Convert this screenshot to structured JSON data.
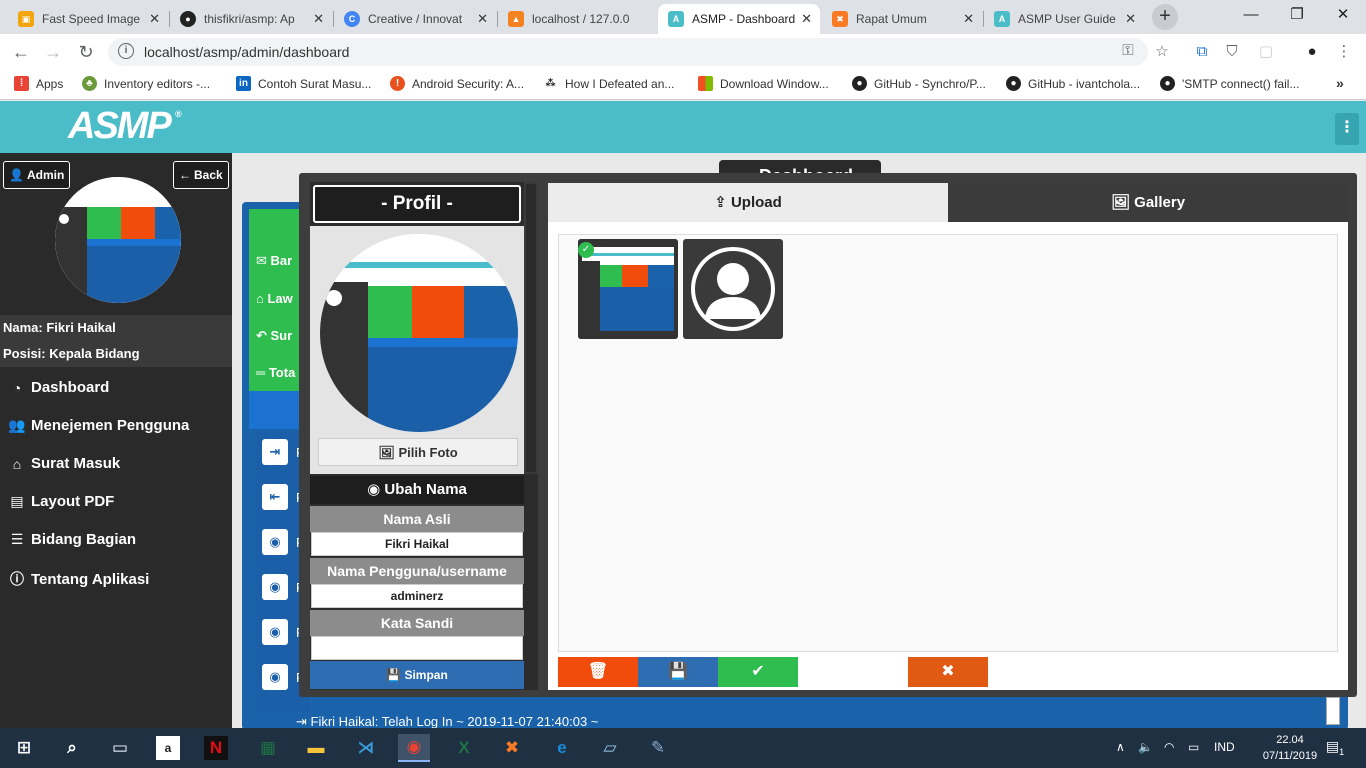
{
  "browser": {
    "tabs": [
      {
        "label": "Fast Speed Image",
        "favicon": "image-icon",
        "color": "#f2a60c"
      },
      {
        "label": "thisfikri/asmp: Ap",
        "favicon": "github-icon",
        "color": "#222222"
      },
      {
        "label": "Creative / Innovat",
        "favicon": "c-icon",
        "color": "#4285f4"
      },
      {
        "label": "localhost / 127.0.0",
        "favicon": "phpmyadmin-icon",
        "color": "#f58220"
      },
      {
        "label": "ASMP - Dashboard",
        "favicon": "asmp-icon",
        "color": "#4bbdc9"
      },
      {
        "label": "Rapat Umum",
        "favicon": "xampp-icon",
        "color": "#fb7a24"
      },
      {
        "label": "ASMP User Guide",
        "favicon": "asmp-icon",
        "color": "#4bbdc9"
      }
    ],
    "active_tab": 4,
    "url": "localhost/asmp/admin/dashboard",
    "bookmarks": [
      {
        "label": "Apps",
        "icon": "apps-grid-icon",
        "color": "#e94335"
      },
      {
        "label": "Inventory editors -...",
        "icon": "tree-icon",
        "color": "#6a9a3a"
      },
      {
        "label": "Contoh Surat Masu...",
        "icon": "linkedin-icon",
        "color": "#0a66c2"
      },
      {
        "label": "Android Security: A...",
        "icon": "android-security-icon",
        "color": "#e8501e"
      },
      {
        "label": "How I Defeated an...",
        "icon": "dots-icon",
        "color": "#222222"
      },
      {
        "label": "Download Window...",
        "icon": "windows-icon",
        "color": "#f25022"
      },
      {
        "label": "GitHub - Synchro/P...",
        "icon": "github-icon",
        "color": "#222222"
      },
      {
        "label": "GitHub - ivantchola...",
        "icon": "github-icon",
        "color": "#222222"
      },
      {
        "label": "'SMTP connect() fail...",
        "icon": "github-icon",
        "color": "#222222"
      }
    ]
  },
  "app": {
    "logo": "ASMP",
    "logo_mark": "®",
    "header_color": "#4bbdc9"
  },
  "sidebar": {
    "admin_label": "Admin",
    "back_label": "Back",
    "nama": "Nama: Fikri Haikal",
    "posisi": "Posisi: Kepala Bidang",
    "items": [
      {
        "label": "Dashboard",
        "icon": "dashboard-icon"
      },
      {
        "label": "Menejemen Pengguna",
        "icon": "users-icon"
      },
      {
        "label": "Surat Masuk",
        "icon": "inbox-icon"
      },
      {
        "label": "Layout PDF",
        "icon": "pdf-icon"
      },
      {
        "label": "Bidang Bagian",
        "icon": "list-icon"
      },
      {
        "label": "Tentang Aplikasi",
        "icon": "info-icon"
      }
    ]
  },
  "main": {
    "dashboard_title": "Dashboard",
    "green_rows": [
      "Bar",
      "Law",
      "Sur",
      "Tota"
    ],
    "list_rows": [
      {
        "icon": "sign-in-icon",
        "text": "F"
      },
      {
        "icon": "sign-out-icon",
        "text": "F"
      },
      {
        "icon": "eye-icon",
        "text": "F"
      },
      {
        "icon": "eye-icon",
        "text": "F"
      },
      {
        "icon": "eye-icon",
        "text": "F"
      },
      {
        "icon": "eye-icon",
        "text": "F"
      }
    ],
    "log_line": "Fikri Haikal: Telah Log In ~ 2019-11-07 21:40:03 ~"
  },
  "modal": {
    "profil_title": "- Profil -",
    "pilih_foto": "Pilih Foto",
    "ubah_nama": "Ubah Nama",
    "nama_asli_label": "Nama Asli",
    "nama_asli_value": "Fikri Haikal",
    "username_label": "Nama Pengguna/username",
    "username_value": "adminerz",
    "password_label": "Kata Sandi",
    "password_value": "",
    "simpan": "Simpan",
    "tab_upload": "Upload",
    "tab_gallery": "Gallery",
    "actions": [
      {
        "name": "delete-button",
        "icon": "trash-icon",
        "glyph": "🗑",
        "color": "#f24c0c"
      },
      {
        "name": "save-button",
        "icon": "floppy-icon",
        "glyph": "💾",
        "color": "#2f6db2"
      },
      {
        "name": "confirm-button",
        "icon": "check-icon",
        "glyph": "✔",
        "color": "#2ebd4e"
      },
      {
        "name": "close-button",
        "icon": "x-icon",
        "glyph": "✖",
        "color": "#e05a14"
      }
    ]
  },
  "taskbar": {
    "lang": "IND",
    "time": "22.04",
    "date": "07/11/2019",
    "notifications": "1"
  }
}
